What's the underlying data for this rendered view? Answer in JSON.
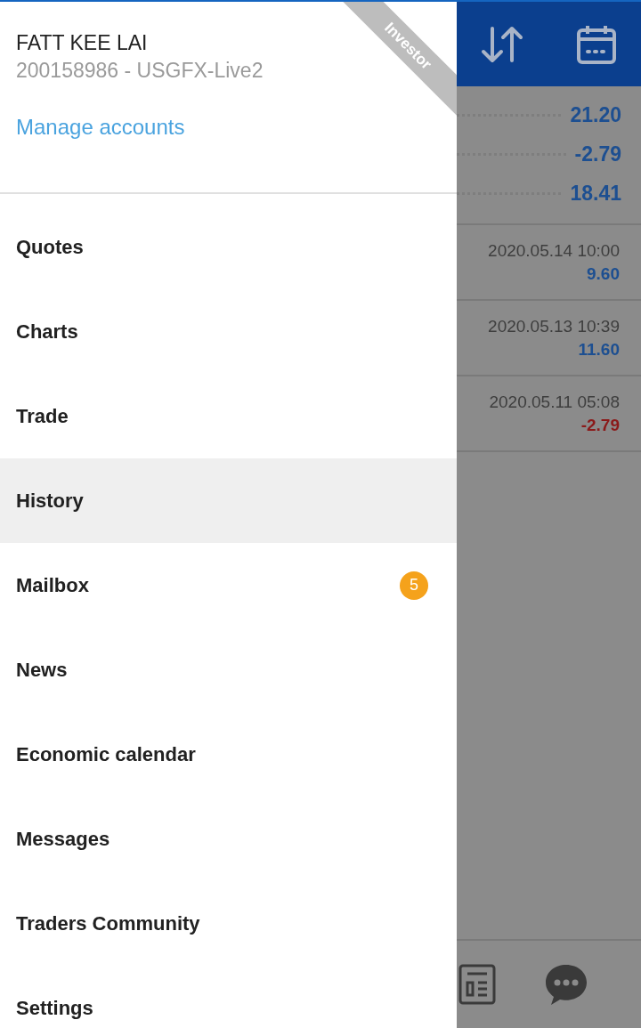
{
  "drawer": {
    "ribbon": "Investor",
    "account": {
      "name": "FATT KEE LAI",
      "number": "200158986 - USGFX-Live2"
    },
    "manage_link": "Manage accounts",
    "menu_items": [
      {
        "label": "Quotes",
        "selected": false
      },
      {
        "label": "Charts",
        "selected": false
      },
      {
        "label": "Trade",
        "selected": false
      },
      {
        "label": "History",
        "selected": true
      },
      {
        "label": "Mailbox",
        "selected": false,
        "badge": "5"
      },
      {
        "label": "News",
        "selected": false
      },
      {
        "label": "Economic calendar",
        "selected": false
      },
      {
        "label": "Messages",
        "selected": false
      },
      {
        "label": "Traders Community",
        "selected": false
      },
      {
        "label": "Settings",
        "selected": false
      }
    ]
  },
  "background": {
    "summary": [
      "21.20",
      "-2.79",
      "18.41"
    ],
    "deals": [
      {
        "time": "2020.05.14 10:00",
        "profit": "9.60",
        "color": "#1d4f91"
      },
      {
        "time": "2020.05.13 10:39",
        "profit": "11.60",
        "color": "#1d4f91"
      },
      {
        "time": "2020.05.11 05:08",
        "profit": "-2.79",
        "color": "#8b1a1a"
      }
    ]
  }
}
